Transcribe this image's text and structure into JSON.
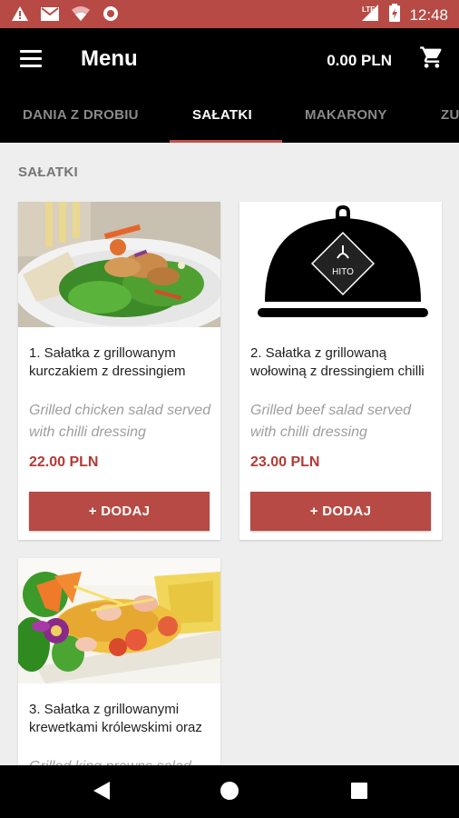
{
  "status_bar": {
    "time": "12:48",
    "icons": [
      "warning-icon",
      "gmail-icon",
      "wifi-icon",
      "sync-icon",
      "lte-signal-icon",
      "battery-icon"
    ]
  },
  "app_bar": {
    "title": "Menu",
    "balance": "0.00 PLN",
    "icons": [
      "hamburger-menu-icon",
      "cart-icon"
    ]
  },
  "tabs": [
    {
      "label": "DANIA Z DROBIU",
      "active": false
    },
    {
      "label": "SAŁATKI",
      "active": true
    },
    {
      "label": "MAKARONY",
      "active": false
    },
    {
      "label": "ZU",
      "active": false
    }
  ],
  "section": {
    "title": "SAŁATKI"
  },
  "items": [
    {
      "name": "1. Sałatka z grillowanym kurczakiem z dressingiem",
      "description": "Grilled chicken salad served with chilli dressing",
      "price": "22.00 PLN",
      "button": "+ DODAJ"
    },
    {
      "name": "2. Sałatka z grillowaną wołowiną z dressingiem chilli",
      "description": "Grilled beef salad served with chilli dressing",
      "price": "23.00 PLN",
      "button": "+ DODAJ",
      "logo_text": "HITO"
    },
    {
      "name": "3. Sałatka z grillowanymi krewetkami królewskimi oraz",
      "description": "Grilled king prawns salad",
      "price": "",
      "button": ""
    }
  ],
  "colors": {
    "status_bar": "#b74a44",
    "accent": "#b74a44",
    "price": "#b33a35",
    "app_bar": "#000000"
  }
}
